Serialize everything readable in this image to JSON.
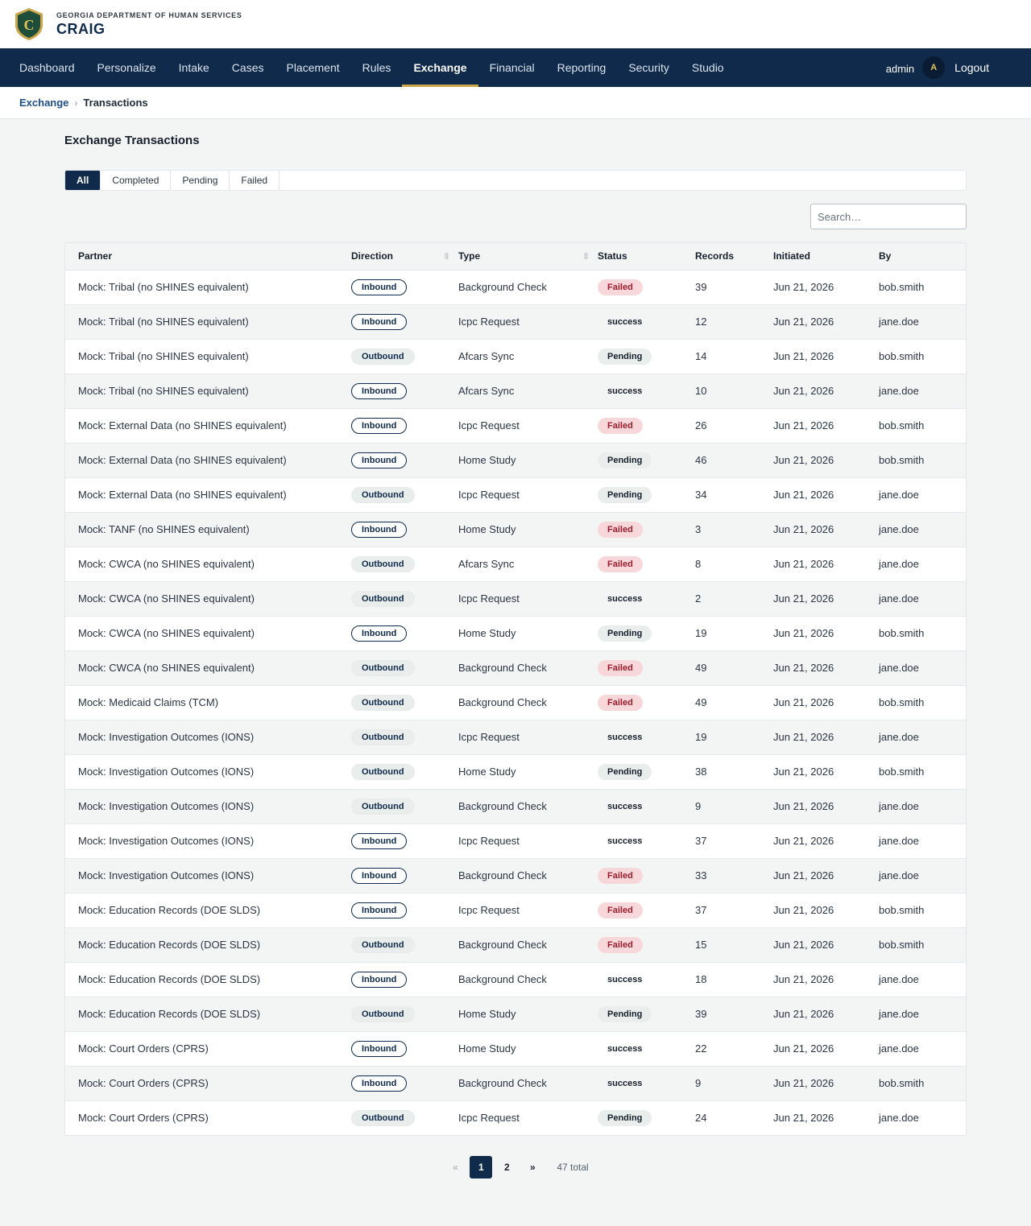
{
  "header": {
    "agency": "GEORGIA DEPARTMENT OF HUMAN SERVICES",
    "app_name": "CRAIG",
    "logo_letter": "C"
  },
  "nav": {
    "items": [
      {
        "label": "Dashboard",
        "active": false
      },
      {
        "label": "Personalize",
        "active": false
      },
      {
        "label": "Intake",
        "active": false
      },
      {
        "label": "Cases",
        "active": false
      },
      {
        "label": "Placement",
        "active": false
      },
      {
        "label": "Rules",
        "active": false
      },
      {
        "label": "Exchange",
        "active": true
      },
      {
        "label": "Financial",
        "active": false
      },
      {
        "label": "Reporting",
        "active": false
      },
      {
        "label": "Security",
        "active": false
      },
      {
        "label": "Studio",
        "active": false
      }
    ],
    "username": "admin",
    "avatar_initial": "A",
    "logout_label": "Logout"
  },
  "breadcrumb": {
    "parent": "Exchange",
    "separator": "›",
    "current": "Transactions"
  },
  "page": {
    "title": "Exchange Transactions",
    "tabs": [
      {
        "label": "All",
        "active": true
      },
      {
        "label": "Completed",
        "active": false
      },
      {
        "label": "Pending",
        "active": false
      },
      {
        "label": "Failed",
        "active": false
      }
    ],
    "search_placeholder": "Search…"
  },
  "table": {
    "columns": [
      "Partner",
      "Direction",
      "Type",
      "Status",
      "Records",
      "Initiated",
      "By"
    ],
    "sort_icon": "⇳",
    "rows": [
      {
        "partner": "Mock: Tribal (no SHINES equivalent)",
        "direction": "Inbound",
        "type": "Background Check",
        "status": "Failed",
        "records": "39",
        "initiated": "Jun 21, 2026",
        "by": "bob.smith"
      },
      {
        "partner": "Mock: Tribal (no SHINES equivalent)",
        "direction": "Inbound",
        "type": "Icpc Request",
        "status": "success",
        "records": "12",
        "initiated": "Jun 21, 2026",
        "by": "jane.doe"
      },
      {
        "partner": "Mock: Tribal (no SHINES equivalent)",
        "direction": "Outbound",
        "type": "Afcars Sync",
        "status": "Pending",
        "records": "14",
        "initiated": "Jun 21, 2026",
        "by": "bob.smith"
      },
      {
        "partner": "Mock: Tribal (no SHINES equivalent)",
        "direction": "Inbound",
        "type": "Afcars Sync",
        "status": "success",
        "records": "10",
        "initiated": "Jun 21, 2026",
        "by": "jane.doe"
      },
      {
        "partner": "Mock: External Data (no SHINES equivalent)",
        "direction": "Inbound",
        "type": "Icpc Request",
        "status": "Failed",
        "records": "26",
        "initiated": "Jun 21, 2026",
        "by": "bob.smith"
      },
      {
        "partner": "Mock: External Data (no SHINES equivalent)",
        "direction": "Inbound",
        "type": "Home Study",
        "status": "Pending",
        "records": "46",
        "initiated": "Jun 21, 2026",
        "by": "bob.smith"
      },
      {
        "partner": "Mock: External Data (no SHINES equivalent)",
        "direction": "Outbound",
        "type": "Icpc Request",
        "status": "Pending",
        "records": "34",
        "initiated": "Jun 21, 2026",
        "by": "jane.doe"
      },
      {
        "partner": "Mock: TANF (no SHINES equivalent)",
        "direction": "Inbound",
        "type": "Home Study",
        "status": "Failed",
        "records": "3",
        "initiated": "Jun 21, 2026",
        "by": "jane.doe"
      },
      {
        "partner": "Mock: CWCA (no SHINES equivalent)",
        "direction": "Outbound",
        "type": "Afcars Sync",
        "status": "Failed",
        "records": "8",
        "initiated": "Jun 21, 2026",
        "by": "jane.doe"
      },
      {
        "partner": "Mock: CWCA (no SHINES equivalent)",
        "direction": "Outbound",
        "type": "Icpc Request",
        "status": "success",
        "records": "2",
        "initiated": "Jun 21, 2026",
        "by": "jane.doe"
      },
      {
        "partner": "Mock: CWCA (no SHINES equivalent)",
        "direction": "Inbound",
        "type": "Home Study",
        "status": "Pending",
        "records": "19",
        "initiated": "Jun 21, 2026",
        "by": "bob.smith"
      },
      {
        "partner": "Mock: CWCA (no SHINES equivalent)",
        "direction": "Outbound",
        "type": "Background Check",
        "status": "Failed",
        "records": "49",
        "initiated": "Jun 21, 2026",
        "by": "jane.doe"
      },
      {
        "partner": "Mock: Medicaid Claims (TCM)",
        "direction": "Outbound",
        "type": "Background Check",
        "status": "Failed",
        "records": "49",
        "initiated": "Jun 21, 2026",
        "by": "bob.smith"
      },
      {
        "partner": "Mock: Investigation Outcomes (IONS)",
        "direction": "Outbound",
        "type": "Icpc Request",
        "status": "success",
        "records": "19",
        "initiated": "Jun 21, 2026",
        "by": "jane.doe"
      },
      {
        "partner": "Mock: Investigation Outcomes (IONS)",
        "direction": "Outbound",
        "type": "Home Study",
        "status": "Pending",
        "records": "38",
        "initiated": "Jun 21, 2026",
        "by": "bob.smith"
      },
      {
        "partner": "Mock: Investigation Outcomes (IONS)",
        "direction": "Outbound",
        "type": "Background Check",
        "status": "success",
        "records": "9",
        "initiated": "Jun 21, 2026",
        "by": "jane.doe"
      },
      {
        "partner": "Mock: Investigation Outcomes (IONS)",
        "direction": "Inbound",
        "type": "Icpc Request",
        "status": "success",
        "records": "37",
        "initiated": "Jun 21, 2026",
        "by": "jane.doe"
      },
      {
        "partner": "Mock: Investigation Outcomes (IONS)",
        "direction": "Inbound",
        "type": "Background Check",
        "status": "Failed",
        "records": "33",
        "initiated": "Jun 21, 2026",
        "by": "jane.doe"
      },
      {
        "partner": "Mock: Education Records (DOE SLDS)",
        "direction": "Inbound",
        "type": "Icpc Request",
        "status": "Failed",
        "records": "37",
        "initiated": "Jun 21, 2026",
        "by": "bob.smith"
      },
      {
        "partner": "Mock: Education Records (DOE SLDS)",
        "direction": "Outbound",
        "type": "Background Check",
        "status": "Failed",
        "records": "15",
        "initiated": "Jun 21, 2026",
        "by": "bob.smith"
      },
      {
        "partner": "Mock: Education Records (DOE SLDS)",
        "direction": "Inbound",
        "type": "Background Check",
        "status": "success",
        "records": "18",
        "initiated": "Jun 21, 2026",
        "by": "jane.doe"
      },
      {
        "partner": "Mock: Education Records (DOE SLDS)",
        "direction": "Outbound",
        "type": "Home Study",
        "status": "Pending",
        "records": "39",
        "initiated": "Jun 21, 2026",
        "by": "jane.doe"
      },
      {
        "partner": "Mock: Court Orders (CPRS)",
        "direction": "Inbound",
        "type": "Home Study",
        "status": "success",
        "records": "22",
        "initiated": "Jun 21, 2026",
        "by": "jane.doe"
      },
      {
        "partner": "Mock: Court Orders (CPRS)",
        "direction": "Inbound",
        "type": "Background Check",
        "status": "success",
        "records": "9",
        "initiated": "Jun 21, 2026",
        "by": "bob.smith"
      },
      {
        "partner": "Mock: Court Orders (CPRS)",
        "direction": "Outbound",
        "type": "Icpc Request",
        "status": "Pending",
        "records": "24",
        "initiated": "Jun 21, 2026",
        "by": "jane.doe"
      }
    ]
  },
  "pagination": {
    "prev": "«",
    "pages": [
      {
        "label": "1",
        "active": true
      },
      {
        "label": "2",
        "active": false
      }
    ],
    "next": "»",
    "total": "47 total"
  },
  "colors": {
    "navy": "#0f2a4a",
    "gold": "#c9a64a",
    "failed_bg": "#f8d7da",
    "failed_text": "#9b1c2c"
  }
}
